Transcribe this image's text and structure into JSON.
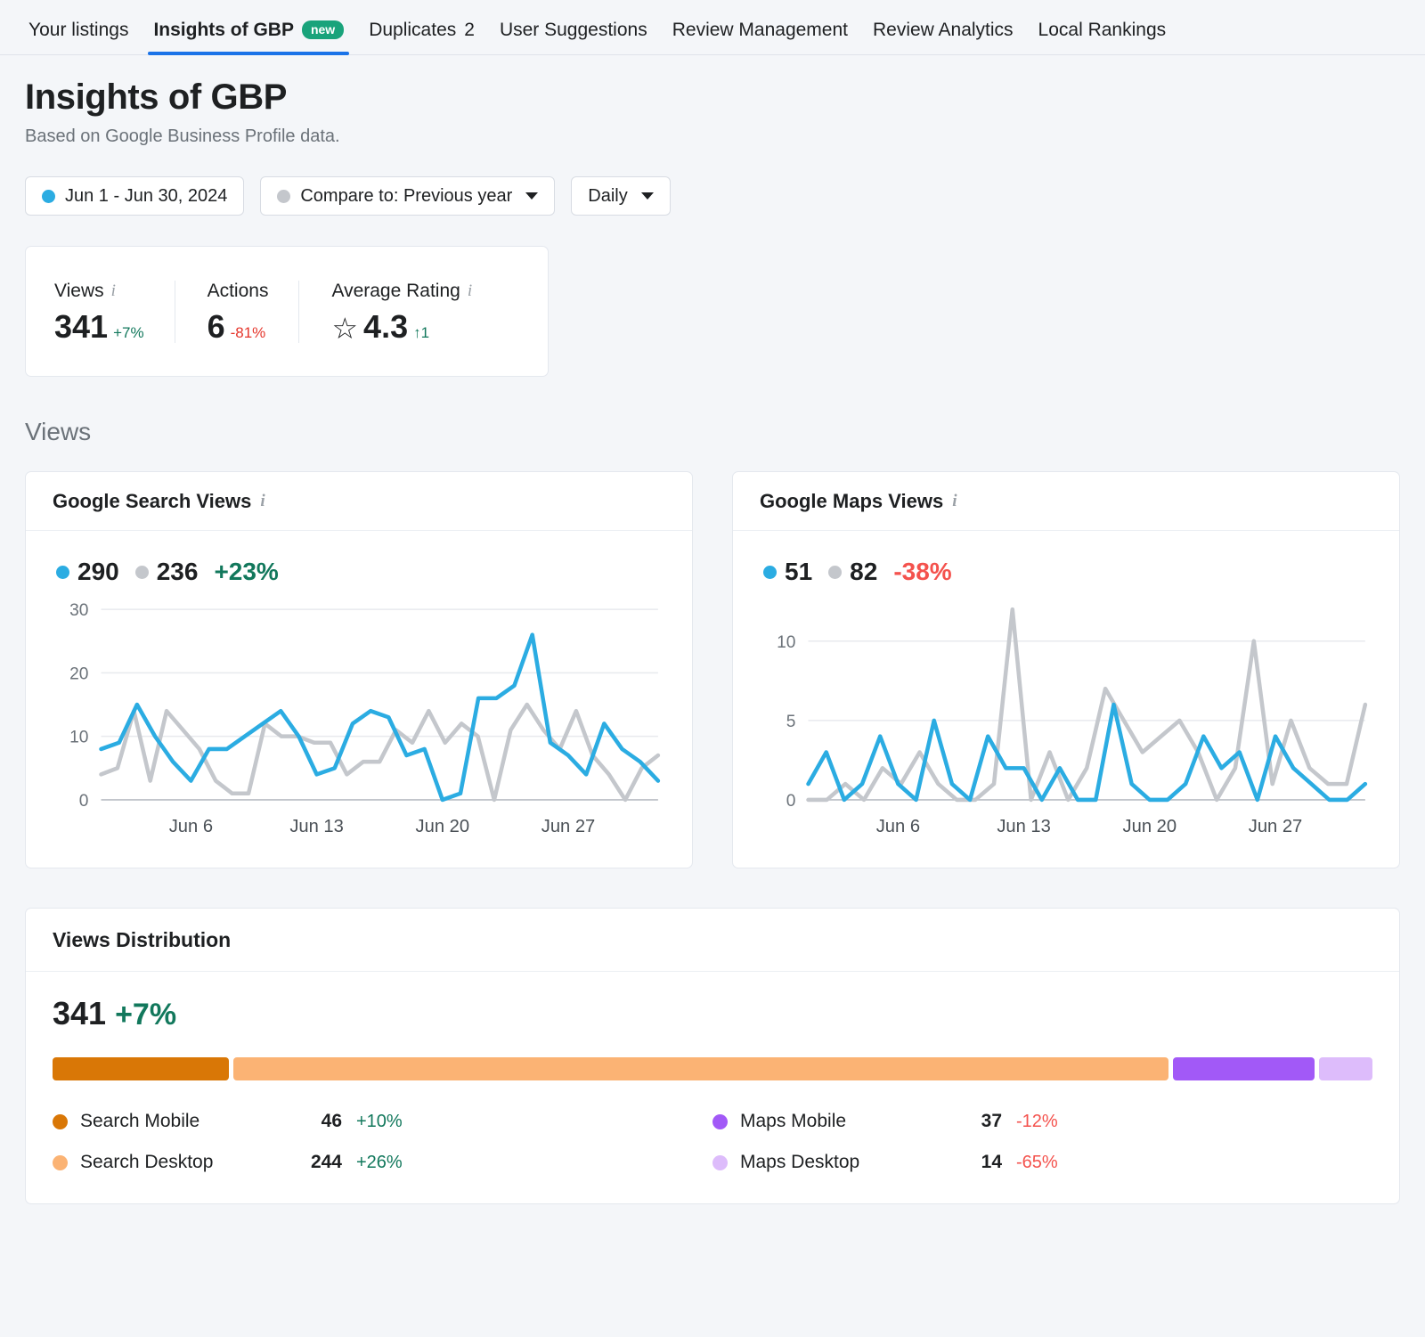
{
  "tabs": [
    {
      "label": "Your listings",
      "active": false,
      "badge": null,
      "count": null
    },
    {
      "label": "Insights of GBP",
      "active": true,
      "badge": "new",
      "count": null
    },
    {
      "label": "Duplicates",
      "active": false,
      "badge": null,
      "count": "2"
    },
    {
      "label": "User Suggestions",
      "active": false,
      "badge": null,
      "count": null
    },
    {
      "label": "Review Management",
      "active": false,
      "badge": null,
      "count": null
    },
    {
      "label": "Review Analytics",
      "active": false,
      "badge": null,
      "count": null
    },
    {
      "label": "Local Rankings",
      "active": false,
      "badge": null,
      "count": null
    }
  ],
  "header": {
    "title": "Insights of GBP",
    "subtitle": "Based on Google Business Profile data."
  },
  "filters": {
    "date_range": "Jun 1 - Jun 30, 2024",
    "compare": "Compare to: Previous year",
    "granularity": "Daily"
  },
  "summary": {
    "views": {
      "label": "Views",
      "value": "341",
      "delta": "+7%",
      "direction": "up"
    },
    "actions": {
      "label": "Actions",
      "value": "6",
      "delta": "-81%",
      "direction": "down"
    },
    "rating": {
      "label": "Average Rating",
      "value": "4.3",
      "delta": "↑1",
      "direction": "up",
      "icon": "star-outline-icon"
    }
  },
  "views_section": {
    "label": "Views"
  },
  "colors": {
    "current": "#2bace2",
    "previous": "#c4c7cc",
    "positive": "#12785c",
    "negative": "#f4524d",
    "accent": "#1a73e8",
    "badge_new": "#19a37b",
    "search_mobile": "#d97706",
    "search_desktop": "#fbb374",
    "maps_mobile": "#a259f7",
    "maps_desktop": "#ddbcfb"
  },
  "chart_data": [
    {
      "type": "line",
      "title": "Google Search Views",
      "id": "google-search-views",
      "current_total": "290",
      "previous_total": "236",
      "change": "+23%",
      "change_direction": "up",
      "xlabel": "",
      "ylabel": "",
      "ylim": [
        0,
        30
      ],
      "yticks": [
        0,
        10,
        20,
        30
      ],
      "grid": true,
      "legend": "inline-top",
      "tick_labels": [
        "Jun 6",
        "Jun 13",
        "Jun 20",
        "Jun 27"
      ],
      "tick_indices": [
        5,
        12,
        19,
        26
      ],
      "x": [
        "Jun 1",
        "Jun 2",
        "Jun 3",
        "Jun 4",
        "Jun 5",
        "Jun 6",
        "Jun 7",
        "Jun 8",
        "Jun 9",
        "Jun 10",
        "Jun 11",
        "Jun 12",
        "Jun 13",
        "Jun 14",
        "Jun 15",
        "Jun 16",
        "Jun 17",
        "Jun 18",
        "Jun 19",
        "Jun 20",
        "Jun 21",
        "Jun 22",
        "Jun 23",
        "Jun 24",
        "Jun 25",
        "Jun 26",
        "Jun 27",
        "Jun 28",
        "Jun 29",
        "Jun 30"
      ],
      "series": [
        {
          "name": "Jun 1 - Jun 30, 2024",
          "color": "#2bace2",
          "values": [
            8,
            9,
            15,
            10,
            6,
            3,
            8,
            8,
            10,
            12,
            14,
            10,
            4,
            5,
            12,
            14,
            13,
            7,
            8,
            0,
            1,
            16,
            16,
            18,
            26,
            9,
            7,
            4,
            12,
            8,
            6,
            3
          ]
        },
        {
          "name": "Previous year",
          "color": "#c4c7cc",
          "values": [
            4,
            5,
            14,
            3,
            14,
            11,
            8,
            3,
            1,
            1,
            12,
            10,
            10,
            9,
            9,
            4,
            6,
            6,
            11,
            9,
            14,
            9,
            12,
            10,
            0,
            11,
            15,
            11,
            8,
            14,
            7,
            4,
            0,
            5,
            7
          ]
        }
      ]
    },
    {
      "type": "line",
      "title": "Google Maps Views",
      "id": "google-maps-views",
      "current_total": "51",
      "previous_total": "82",
      "change": "-38%",
      "change_direction": "down",
      "xlabel": "",
      "ylabel": "",
      "ylim": [
        0,
        12
      ],
      "yticks": [
        0,
        5,
        10
      ],
      "grid": true,
      "legend": "inline-top",
      "tick_labels": [
        "Jun 6",
        "Jun 13",
        "Jun 20",
        "Jun 27"
      ],
      "tick_indices": [
        5,
        12,
        19,
        26
      ],
      "x": [
        "Jun 1",
        "Jun 2",
        "Jun 3",
        "Jun 4",
        "Jun 5",
        "Jun 6",
        "Jun 7",
        "Jun 8",
        "Jun 9",
        "Jun 10",
        "Jun 11",
        "Jun 12",
        "Jun 13",
        "Jun 14",
        "Jun 15",
        "Jun 16",
        "Jun 17",
        "Jun 18",
        "Jun 19",
        "Jun 20",
        "Jun 21",
        "Jun 22",
        "Jun 23",
        "Jun 24",
        "Jun 25",
        "Jun 26",
        "Jun 27",
        "Jun 28",
        "Jun 29",
        "Jun 30"
      ],
      "series": [
        {
          "name": "Jun 1 - Jun 30, 2024",
          "color": "#2bace2",
          "values": [
            1,
            3,
            0,
            1,
            4,
            1,
            0,
            5,
            1,
            0,
            4,
            2,
            2,
            0,
            2,
            0,
            0,
            6,
            1,
            0,
            0,
            1,
            4,
            2,
            3,
            0,
            4,
            2,
            1,
            0,
            0,
            1
          ]
        },
        {
          "name": "Previous year",
          "color": "#c4c7cc",
          "values": [
            0,
            0,
            1,
            0,
            2,
            1,
            3,
            1,
            0,
            0,
            1,
            12,
            0,
            3,
            0,
            2,
            7,
            5,
            3,
            4,
            5,
            3,
            0,
            2,
            10,
            1,
            5,
            2,
            1,
            1,
            6
          ]
        }
      ]
    },
    {
      "type": "bar",
      "id": "views-distribution",
      "title": "Views Distribution",
      "total": "341",
      "total_change": "+7%",
      "total_change_direction": "up",
      "categories": [
        "Search Mobile",
        "Search Desktop",
        "Maps Mobile",
        "Maps Desktop"
      ],
      "values": [
        46,
        244,
        37,
        14
      ],
      "deltas": [
        "+10%",
        "+26%",
        "-12%",
        "-65%"
      ],
      "delta_directions": [
        "up",
        "up",
        "down",
        "down"
      ],
      "segment_colors": [
        "#d97706",
        "#fbb374",
        "#a259f7",
        "#ddbcfb"
      ]
    }
  ],
  "distribution": {
    "items": [
      {
        "name": "Search Mobile",
        "value": "46",
        "delta": "+10%",
        "direction": "up",
        "color": "#d97706"
      },
      {
        "name": "Maps Mobile",
        "value": "37",
        "delta": "-12%",
        "direction": "down",
        "color": "#a259f7"
      },
      {
        "name": "Search Desktop",
        "value": "244",
        "delta": "+26%",
        "direction": "up",
        "color": "#fbb374"
      },
      {
        "name": "Maps Desktop",
        "value": "14",
        "delta": "-65%",
        "direction": "down",
        "color": "#ddbcfb"
      }
    ]
  }
}
